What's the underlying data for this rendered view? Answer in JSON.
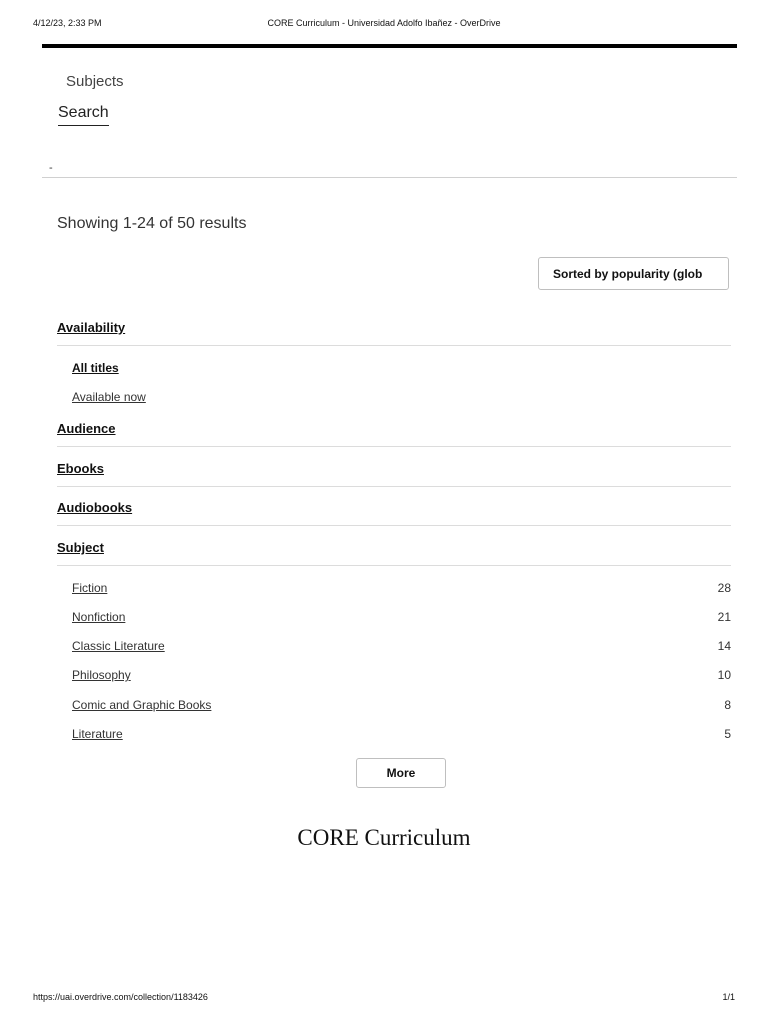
{
  "print_header": {
    "datetime": "4/12/23, 2:33 PM",
    "title": "CORE Curriculum - Universidad Adolfo Ibañez - OverDrive"
  },
  "nav": {
    "subjects_label": "Subjects",
    "search_label": "Search",
    "dash": "-"
  },
  "results_text": "Showing 1-24 of 50 results",
  "sort_label": "Sorted by popularity (glob",
  "facets": {
    "availability": {
      "label": "Availability",
      "options": [
        {
          "label": "All titles",
          "selected": true
        },
        {
          "label": "Available now",
          "selected": false
        }
      ]
    },
    "audience": {
      "label": "Audience"
    },
    "ebooks": {
      "label": "Ebooks"
    },
    "audiobooks": {
      "label": "Audiobooks"
    },
    "subject": {
      "label": "Subject",
      "items": [
        {
          "label": "Fiction",
          "count": "28"
        },
        {
          "label": "Nonfiction",
          "count": "21"
        },
        {
          "label": "Classic Literature",
          "count": "14"
        },
        {
          "label": "Philosophy",
          "count": "10"
        },
        {
          "label": "Comic and Graphic Books",
          "count": "8"
        },
        {
          "label": "Literature",
          "count": "5"
        }
      ]
    }
  },
  "more_label": "More",
  "collection_title": "CORE Curriculum",
  "print_footer": {
    "url": "https://uai.overdrive.com/collection/1183426",
    "page": "1/1"
  }
}
